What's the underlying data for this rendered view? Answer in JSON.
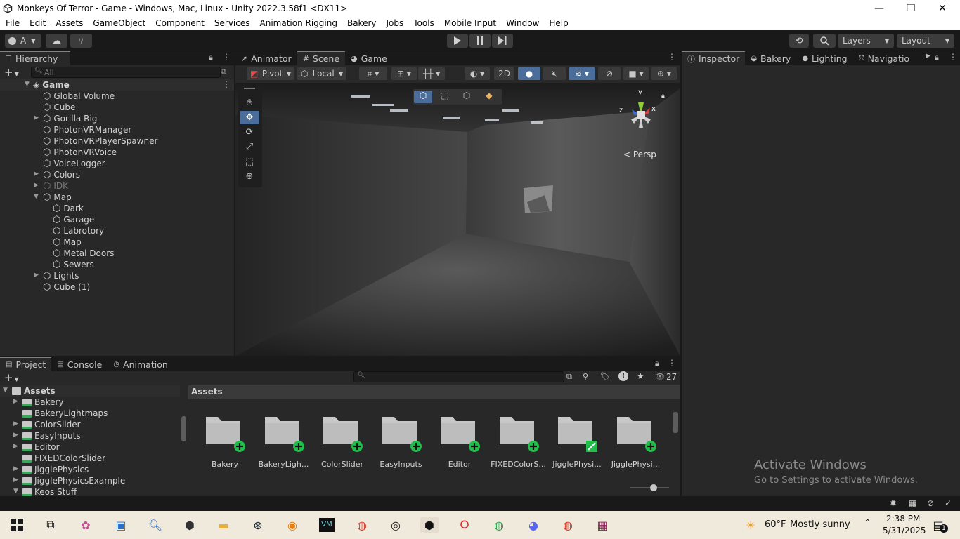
{
  "window": {
    "title": "Monkeys Of Terror - Game - Windows, Mac, Linux - Unity 2022.3.58f1 <DX11>",
    "minimize": "—",
    "maximize": "❐",
    "close": "✕"
  },
  "menu": [
    "File",
    "Edit",
    "Assets",
    "GameObject",
    "Component",
    "Services",
    "Animation Rigging",
    "Bakery",
    "Jobs",
    "Tools",
    "Mobile Input",
    "Window",
    "Help"
  ],
  "toolbar": {
    "account": "A",
    "layers": "Layers",
    "layout": "Layout"
  },
  "hierarchy": {
    "tab": "Hierarchy",
    "search_placeholder": "All",
    "scene": "Game",
    "items": [
      {
        "label": "Global Volume",
        "depth": 1,
        "arrow": false
      },
      {
        "label": "Cube",
        "depth": 1,
        "arrow": false
      },
      {
        "label": "Gorilla Rig",
        "depth": 1,
        "arrow": "right"
      },
      {
        "label": "PhotonVRManager",
        "depth": 1,
        "arrow": false
      },
      {
        "label": "PhotonVRPlayerSpawner",
        "depth": 1,
        "arrow": false
      },
      {
        "label": "PhotonVRVoice",
        "depth": 1,
        "arrow": false
      },
      {
        "label": "VoiceLogger",
        "depth": 1,
        "arrow": false
      },
      {
        "label": "Colors",
        "depth": 1,
        "arrow": "right"
      },
      {
        "label": "IDK",
        "depth": 1,
        "arrow": "right",
        "dim": true
      },
      {
        "label": "Map",
        "depth": 1,
        "arrow": "down"
      },
      {
        "label": "Dark",
        "depth": 2,
        "arrow": false
      },
      {
        "label": "Garage",
        "depth": 2,
        "arrow": false
      },
      {
        "label": "Labrotory",
        "depth": 2,
        "arrow": false
      },
      {
        "label": "Map",
        "depth": 2,
        "arrow": false
      },
      {
        "label": "Metal Doors",
        "depth": 2,
        "arrow": false
      },
      {
        "label": "Sewers",
        "depth": 2,
        "arrow": false
      },
      {
        "label": "Lights",
        "depth": 1,
        "arrow": "right"
      },
      {
        "label": "Cube (1)",
        "depth": 1,
        "arrow": false
      }
    ]
  },
  "scene": {
    "tabs": [
      "Animator",
      "Scene",
      "Game"
    ],
    "pivot": "Pivot",
    "local": "Local",
    "mode_2d": "2D",
    "persp": "Persp",
    "axes": {
      "x": "x",
      "y": "y",
      "z": "z"
    }
  },
  "inspector": {
    "tabs": [
      "Inspector",
      "Bakery",
      "Lighting",
      "Navigatio"
    ]
  },
  "project": {
    "tabs": [
      "Project",
      "Console",
      "Animation"
    ],
    "root": "Assets",
    "tree": [
      "Bakery",
      "BakeryLightmaps",
      "ColorSlider",
      "EasyInputs",
      "Editor",
      "FIXEDColorSlider",
      "JigglePhysics",
      "JigglePhysicsExample",
      "Keos Stuff"
    ],
    "breadcrumb": "Assets",
    "count": "27",
    "folders": [
      "Bakery",
      "BakeryLigh...",
      "ColorSlider",
      "EasyInputs",
      "Editor",
      "FIXEDColorS...",
      "JigglePhysi...",
      "JigglePhysi..."
    ]
  },
  "watermark": {
    "line1": "Activate Windows",
    "line2": "Go to Settings to activate Windows."
  },
  "taskbar": {
    "weather_temp": "60°F",
    "weather_text": "Mostly sunny",
    "time": "2:38 PM",
    "date": "5/31/2025",
    "notif_count": "1"
  }
}
